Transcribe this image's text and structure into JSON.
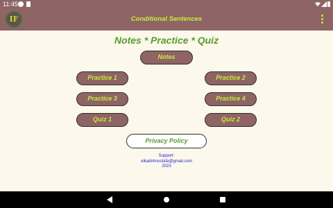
{
  "status_bar": {
    "time": "11:45",
    "icons": [
      "notification-dot-icon",
      "sd-card-icon",
      "wifi-icon",
      "signal-icon",
      "battery-icon"
    ]
  },
  "app_bar": {
    "logo_text": "IF",
    "title": "Conditional Sentences",
    "menu_icon": "more-vert-icon"
  },
  "main": {
    "heading": "Notes * Practice * Quiz",
    "buttons": {
      "notes": "Notes",
      "practice1": "Practice 1",
      "practice2": "Practice 2",
      "practice3": "Practice 3",
      "practice4": "Practice 4",
      "quiz1": "Quiz 1",
      "quiz2": "Quiz 2",
      "privacy": "Privacy Policy"
    },
    "support": {
      "label": "Support:",
      "email": "elkadirimostafa@gmail.com",
      "year": "2023"
    }
  },
  "nav_bar": {
    "icons": [
      "back-icon",
      "home-icon",
      "recents-icon"
    ]
  },
  "colors": {
    "app_bar": "#8e6464",
    "accent": "#c8ec3a",
    "heading": "#5a9a2e",
    "background": "#fdf8ec",
    "link": "#2424c8"
  }
}
